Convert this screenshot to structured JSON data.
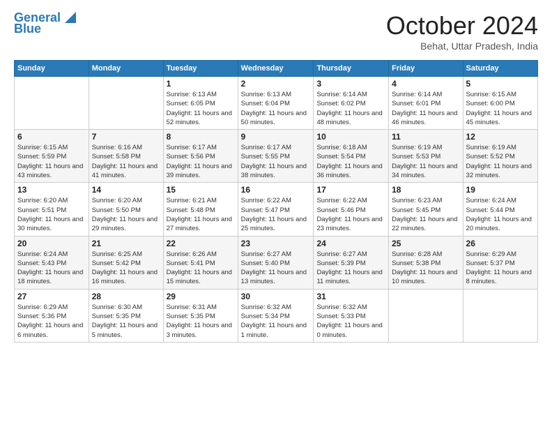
{
  "logo": {
    "line1": "General",
    "line2": "Blue"
  },
  "title": "October 2024",
  "subtitle": "Behat, Uttar Pradesh, India",
  "days_of_week": [
    "Sunday",
    "Monday",
    "Tuesday",
    "Wednesday",
    "Thursday",
    "Friday",
    "Saturday"
  ],
  "weeks": [
    [
      {
        "day": "",
        "info": ""
      },
      {
        "day": "",
        "info": ""
      },
      {
        "day": "1",
        "info": "Sunrise: 6:13 AM\nSunset: 6:05 PM\nDaylight: 11 hours and 52 minutes."
      },
      {
        "day": "2",
        "info": "Sunrise: 6:13 AM\nSunset: 6:04 PM\nDaylight: 11 hours and 50 minutes."
      },
      {
        "day": "3",
        "info": "Sunrise: 6:14 AM\nSunset: 6:02 PM\nDaylight: 11 hours and 48 minutes."
      },
      {
        "day": "4",
        "info": "Sunrise: 6:14 AM\nSunset: 6:01 PM\nDaylight: 11 hours and 46 minutes."
      },
      {
        "day": "5",
        "info": "Sunrise: 6:15 AM\nSunset: 6:00 PM\nDaylight: 11 hours and 45 minutes."
      }
    ],
    [
      {
        "day": "6",
        "info": "Sunrise: 6:15 AM\nSunset: 5:59 PM\nDaylight: 11 hours and 43 minutes."
      },
      {
        "day": "7",
        "info": "Sunrise: 6:16 AM\nSunset: 5:58 PM\nDaylight: 11 hours and 41 minutes."
      },
      {
        "day": "8",
        "info": "Sunrise: 6:17 AM\nSunset: 5:56 PM\nDaylight: 11 hours and 39 minutes."
      },
      {
        "day": "9",
        "info": "Sunrise: 6:17 AM\nSunset: 5:55 PM\nDaylight: 11 hours and 38 minutes."
      },
      {
        "day": "10",
        "info": "Sunrise: 6:18 AM\nSunset: 5:54 PM\nDaylight: 11 hours and 36 minutes."
      },
      {
        "day": "11",
        "info": "Sunrise: 6:19 AM\nSunset: 5:53 PM\nDaylight: 11 hours and 34 minutes."
      },
      {
        "day": "12",
        "info": "Sunrise: 6:19 AM\nSunset: 5:52 PM\nDaylight: 11 hours and 32 minutes."
      }
    ],
    [
      {
        "day": "13",
        "info": "Sunrise: 6:20 AM\nSunset: 5:51 PM\nDaylight: 11 hours and 30 minutes."
      },
      {
        "day": "14",
        "info": "Sunrise: 6:20 AM\nSunset: 5:50 PM\nDaylight: 11 hours and 29 minutes."
      },
      {
        "day": "15",
        "info": "Sunrise: 6:21 AM\nSunset: 5:48 PM\nDaylight: 11 hours and 27 minutes."
      },
      {
        "day": "16",
        "info": "Sunrise: 6:22 AM\nSunset: 5:47 PM\nDaylight: 11 hours and 25 minutes."
      },
      {
        "day": "17",
        "info": "Sunrise: 6:22 AM\nSunset: 5:46 PM\nDaylight: 11 hours and 23 minutes."
      },
      {
        "day": "18",
        "info": "Sunrise: 6:23 AM\nSunset: 5:45 PM\nDaylight: 11 hours and 22 minutes."
      },
      {
        "day": "19",
        "info": "Sunrise: 6:24 AM\nSunset: 5:44 PM\nDaylight: 11 hours and 20 minutes."
      }
    ],
    [
      {
        "day": "20",
        "info": "Sunrise: 6:24 AM\nSunset: 5:43 PM\nDaylight: 11 hours and 18 minutes."
      },
      {
        "day": "21",
        "info": "Sunrise: 6:25 AM\nSunset: 5:42 PM\nDaylight: 11 hours and 16 minutes."
      },
      {
        "day": "22",
        "info": "Sunrise: 6:26 AM\nSunset: 5:41 PM\nDaylight: 11 hours and 15 minutes."
      },
      {
        "day": "23",
        "info": "Sunrise: 6:27 AM\nSunset: 5:40 PM\nDaylight: 11 hours and 13 minutes."
      },
      {
        "day": "24",
        "info": "Sunrise: 6:27 AM\nSunset: 5:39 PM\nDaylight: 11 hours and 11 minutes."
      },
      {
        "day": "25",
        "info": "Sunrise: 6:28 AM\nSunset: 5:38 PM\nDaylight: 11 hours and 10 minutes."
      },
      {
        "day": "26",
        "info": "Sunrise: 6:29 AM\nSunset: 5:37 PM\nDaylight: 11 hours and 8 minutes."
      }
    ],
    [
      {
        "day": "27",
        "info": "Sunrise: 6:29 AM\nSunset: 5:36 PM\nDaylight: 11 hours and 6 minutes."
      },
      {
        "day": "28",
        "info": "Sunrise: 6:30 AM\nSunset: 5:35 PM\nDaylight: 11 hours and 5 minutes."
      },
      {
        "day": "29",
        "info": "Sunrise: 6:31 AM\nSunset: 5:35 PM\nDaylight: 11 hours and 3 minutes."
      },
      {
        "day": "30",
        "info": "Sunrise: 6:32 AM\nSunset: 5:34 PM\nDaylight: 11 hours and 1 minute."
      },
      {
        "day": "31",
        "info": "Sunrise: 6:32 AM\nSunset: 5:33 PM\nDaylight: 11 hours and 0 minutes."
      },
      {
        "day": "",
        "info": ""
      },
      {
        "day": "",
        "info": ""
      }
    ]
  ]
}
